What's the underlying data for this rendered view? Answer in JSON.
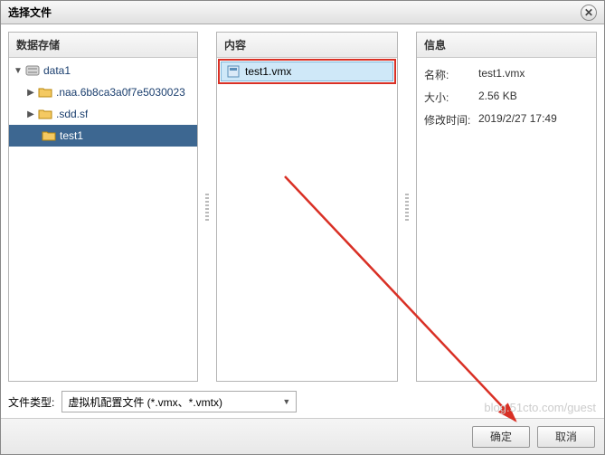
{
  "dialog": {
    "title": "选择文件"
  },
  "panels": {
    "storage": {
      "title": "数据存储"
    },
    "content": {
      "title": "内容"
    },
    "info": {
      "title": "信息"
    }
  },
  "tree": {
    "root": "data1",
    "items": [
      {
        "label": ".naa.6b8ca3a0f7e5030023"
      },
      {
        "label": ".sdd.sf"
      },
      {
        "label": "test1"
      }
    ]
  },
  "files": {
    "selected": "test1.vmx"
  },
  "info": {
    "nameLabel": "名称:",
    "nameValue": "test1.vmx",
    "sizeLabel": "大小:",
    "sizeValue": "2.56 KB",
    "mtimeLabel": "修改时间:",
    "mtimeValue": "2019/2/27 17:49"
  },
  "filetype": {
    "label": "文件类型:",
    "value": "虚拟机配置文件 (*.vmx、*.vmtx)"
  },
  "buttons": {
    "ok": "确定",
    "cancel": "取消"
  },
  "watermark": "blog.51cto.com/guest"
}
